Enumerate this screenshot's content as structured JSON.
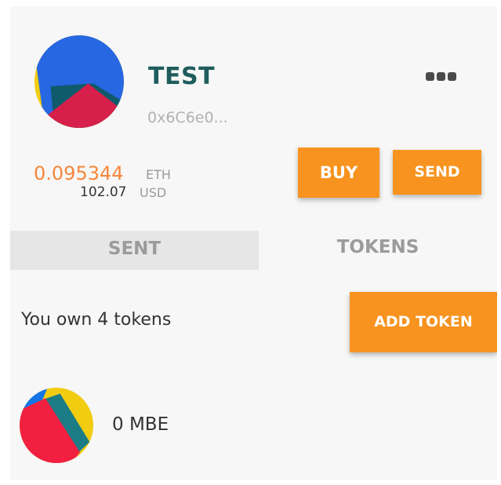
{
  "account": {
    "name": "TEST",
    "address": "0x6C6e0...",
    "more_icon": "more-horizontal-icon",
    "avatar_icon": "identicon-avatar",
    "avatar_colors": [
      "#f2cc11",
      "#2767e2",
      "#0f5a6b",
      "#d61f4a"
    ]
  },
  "balance": {
    "eth_value": "0.095344",
    "eth_unit": "ETH",
    "usd_value": "102.07",
    "usd_unit": "USD"
  },
  "actions": {
    "buy_label": "BUY",
    "send_label": "SEND"
  },
  "tabs": [
    {
      "label": "SENT",
      "active": false
    },
    {
      "label": "TOKENS",
      "active": true
    }
  ],
  "tokens": {
    "count_text": "You own 4 tokens",
    "add_label": "ADD TOKEN",
    "items": [
      {
        "balance": "0 MBE",
        "icon": "identicon-token",
        "icon_colors": [
          "#f2cc11",
          "#1b7c86",
          "#f11f40",
          "#1575e6"
        ]
      }
    ]
  },
  "colors": {
    "accent": "#f7931e",
    "eth_balance": "#f7863b",
    "account_name": "#1f5c5d",
    "muted": "#9b9b9b"
  }
}
